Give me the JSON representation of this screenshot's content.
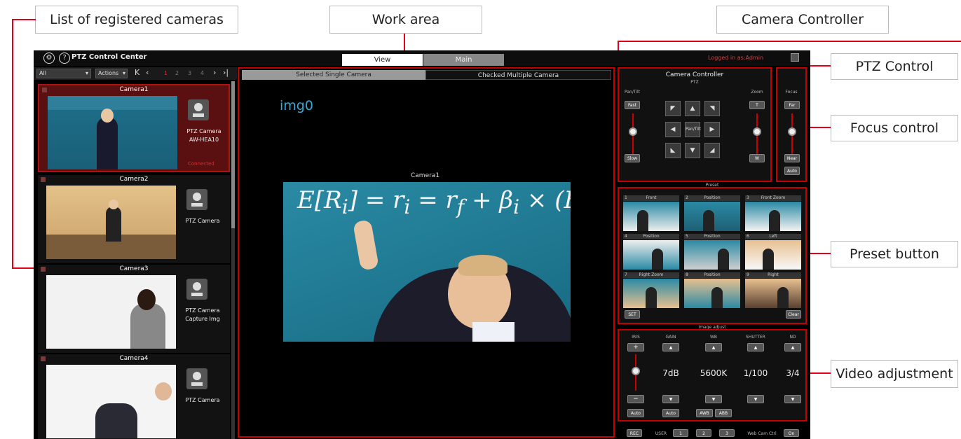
{
  "callouts": {
    "cameras": "List of registered cameras",
    "work": "Work area",
    "controller": "Camera Controller",
    "ptz": "PTZ Control",
    "focus": "Focus control",
    "preset": "Preset button",
    "video": "Video adjustment"
  },
  "app": {
    "title": "PTZ Control Center",
    "tabs": [
      "View",
      "Main"
    ],
    "logged_in": "Logged in as:Admin",
    "help_icon": "question-icon",
    "settings_icon": "settings-icon"
  },
  "toolbar": {
    "group": "All",
    "actions": "Actions",
    "pages": [
      "1",
      "2",
      "3",
      "4"
    ]
  },
  "cameras": [
    {
      "name": "Camera1",
      "type": "PTZ Camera",
      "model": "AW-HEA10",
      "status": "Connected"
    },
    {
      "name": "Camera2",
      "type": "PTZ Camera",
      "model": ""
    },
    {
      "name": "Camera3",
      "type": "PTZ Camera",
      "model": "Capture Img"
    },
    {
      "name": "Camera4",
      "type": "PTZ Camera",
      "model": ""
    }
  ],
  "work": {
    "tabs": [
      "Selected Single Camera",
      "Checked Multiple Camera"
    ],
    "img_label": "img0",
    "camera_label": "Camera1"
  },
  "controller": {
    "title": "Camera Controller",
    "ptz_label": "PTZ",
    "pantilt_label": "Pan/Tilt",
    "fast": "Fast",
    "slow": "Slow",
    "pantilt_center": "Pan/Tilt",
    "zoom_label": "Zoom",
    "zoom_t": "T",
    "zoom_w": "W",
    "focus_label": "Focus",
    "focus_far": "Far",
    "focus_near": "Near",
    "focus_auto": "Auto"
  },
  "preset": {
    "label": "Preset",
    "items": [
      {
        "num": "1",
        "name": "Front"
      },
      {
        "num": "2",
        "name": "Position"
      },
      {
        "num": "3",
        "name": "Front Zoom"
      },
      {
        "num": "4",
        "name": "Position"
      },
      {
        "num": "5",
        "name": "Position"
      },
      {
        "num": "6",
        "name": "Left"
      },
      {
        "num": "7",
        "name": "Right Zoom"
      },
      {
        "num": "8",
        "name": "Position"
      },
      {
        "num": "9",
        "name": "Right"
      }
    ],
    "set": "SET",
    "clear": "Clear"
  },
  "image": {
    "label": "Image adjust",
    "cols": [
      "IRIS",
      "GAIN",
      "WB",
      "SHUTTER",
      "ND"
    ],
    "values": [
      "",
      "7dB",
      "5600K",
      "1/100",
      "3/4"
    ],
    "iris_plus": "+",
    "iris_minus": "−",
    "auto": "Auto",
    "awb": "AWB",
    "abb": "ABB"
  },
  "bottom": {
    "rec": "REC",
    "user": "USER",
    "user_btns": [
      "1",
      "2",
      "3"
    ],
    "webcam": "Web Cam Ctrl",
    "on": "On"
  }
}
